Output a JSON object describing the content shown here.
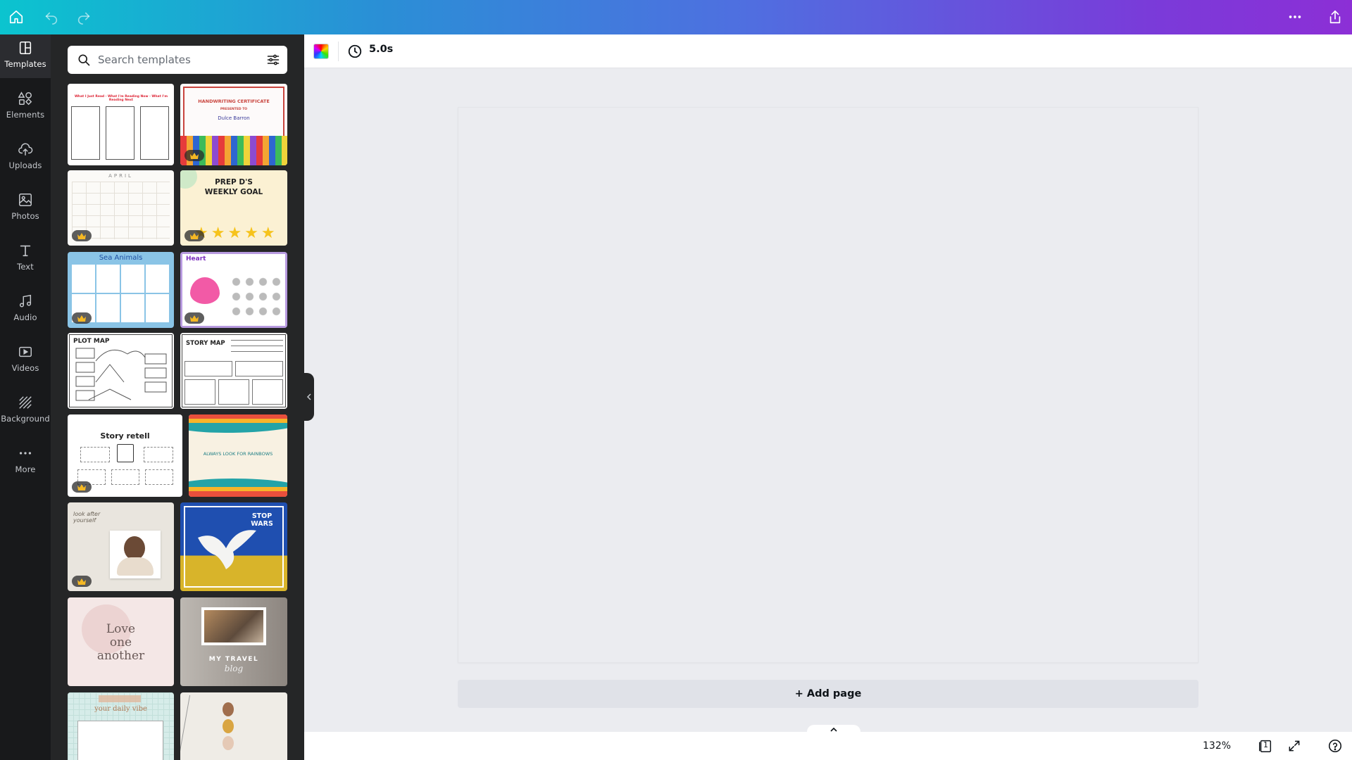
{
  "topbar": {
    "home_icon": "home-icon",
    "undo_icon": "undo-icon",
    "redo_icon": "redo-icon",
    "more_icon": "more-horizontal-icon",
    "share_icon": "share-icon"
  },
  "rail": {
    "items": [
      {
        "label": "Templates",
        "icon": "templates-icon",
        "active": true
      },
      {
        "label": "Elements",
        "icon": "elements-icon"
      },
      {
        "label": "Uploads",
        "icon": "uploads-icon"
      },
      {
        "label": "Photos",
        "icon": "photos-icon"
      },
      {
        "label": "Text",
        "icon": "text-icon"
      },
      {
        "label": "Audio",
        "icon": "audio-icon"
      },
      {
        "label": "Videos",
        "icon": "videos-icon"
      },
      {
        "label": "Background",
        "icon": "background-icon"
      },
      {
        "label": "More",
        "icon": "more-icon"
      }
    ]
  },
  "panel": {
    "search_placeholder": "Search templates",
    "templates": [
      {
        "title": "What I Just Read · What I'm Reading Now · What I'm Reading Next",
        "premium": false
      },
      {
        "title": "HANDWRITING CERTIFICATE",
        "subtitle": "PRESENTED TO",
        "name": "Dulce Barron",
        "premium": true
      },
      {
        "title": "APRIL",
        "premium": true
      },
      {
        "title": "PREP D'S WEEKLY GOAL",
        "premium": true
      },
      {
        "title": "Sea Animals",
        "premium": true
      },
      {
        "title": "Heart",
        "premium": true
      },
      {
        "title": "PLOT MAP",
        "premium": false
      },
      {
        "title": "STORY MAP",
        "premium": false
      },
      {
        "title": "Story retell",
        "premium": true
      },
      {
        "title": "ALWAYS LOOK FOR RAINBOWS",
        "premium": false
      },
      {
        "title": "look after yourself",
        "premium": true
      },
      {
        "title": "STOP WARS",
        "premium": false
      },
      {
        "title": "Love one another",
        "premium": false
      },
      {
        "title": "MY TRAVEL",
        "subtitle": "blog",
        "premium": false
      },
      {
        "title": "your daily vibe",
        "premium": false
      },
      {
        "title": "",
        "premium": false
      }
    ]
  },
  "toolbar": {
    "color_icon": "color-swatch-icon",
    "timer_icon": "clock-icon",
    "duration": "5.0s"
  },
  "editor": {
    "add_page_label": "+ Add page"
  },
  "footer": {
    "zoom": "132%",
    "page_count": "1"
  },
  "colors": {
    "rail_bg": "#18191b",
    "panel_bg": "#252627",
    "canvas_bg": "#ebecf0",
    "gradient_start": "#0bc4cf",
    "gradient_end": "#8c2fd6"
  }
}
